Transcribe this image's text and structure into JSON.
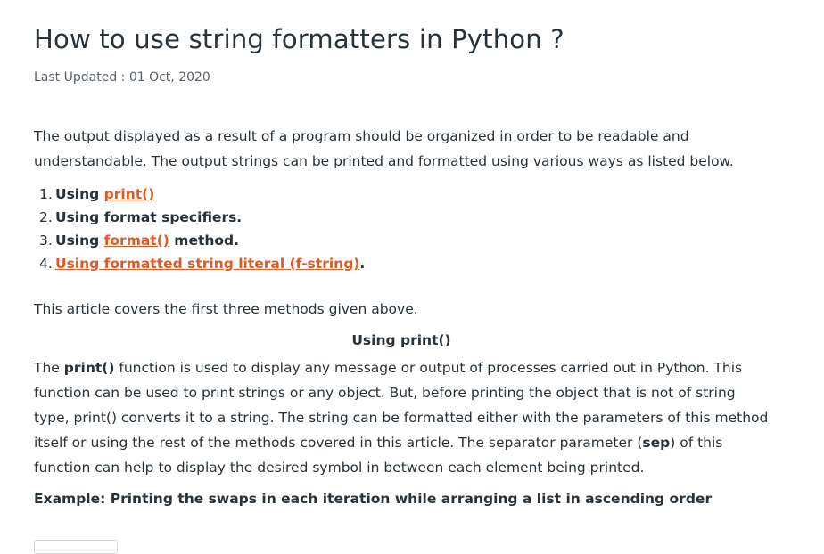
{
  "article": {
    "title": "How to use string formatters in Python ?",
    "last_updated": "Last Updated : 01 Oct, 2020",
    "intro": "The output displayed as a result of a program should be organized in order to be readable and understandable. The output strings can be printed and formatted using various ways as listed below.",
    "methods": [
      {
        "num": "1.",
        "prefix": "Using ",
        "link": "print()",
        "suffix": ""
      },
      {
        "num": "2.",
        "prefix": "Using format specifiers.",
        "link": "",
        "suffix": ""
      },
      {
        "num": "3.",
        "prefix": "Using ",
        "link": "format()",
        "suffix": " method."
      },
      {
        "num": "4.",
        "prefix": "",
        "link": "Using formatted string literal (f-string)",
        "suffix": "."
      }
    ],
    "covers": "This article covers the first three methods given above.",
    "section_heading": "Using print()",
    "section_body": {
      "t1": "The ",
      "b1": "print()",
      "t2": " function is used to display any message or output of processes carried out in Python. This function can be used to print strings or any object. But, before printing the object that is not of string type, print() converts it to a string. The string can be formatted either with the parameters of this method itself or using the rest of the methods covered in this article. The separator parameter (",
      "b2": "sep",
      "t3": ") of this function can help to display the desired symbol in between each element being printed."
    },
    "example": "Example: Printing the swaps in each iteration while arranging a list in ascending order"
  }
}
